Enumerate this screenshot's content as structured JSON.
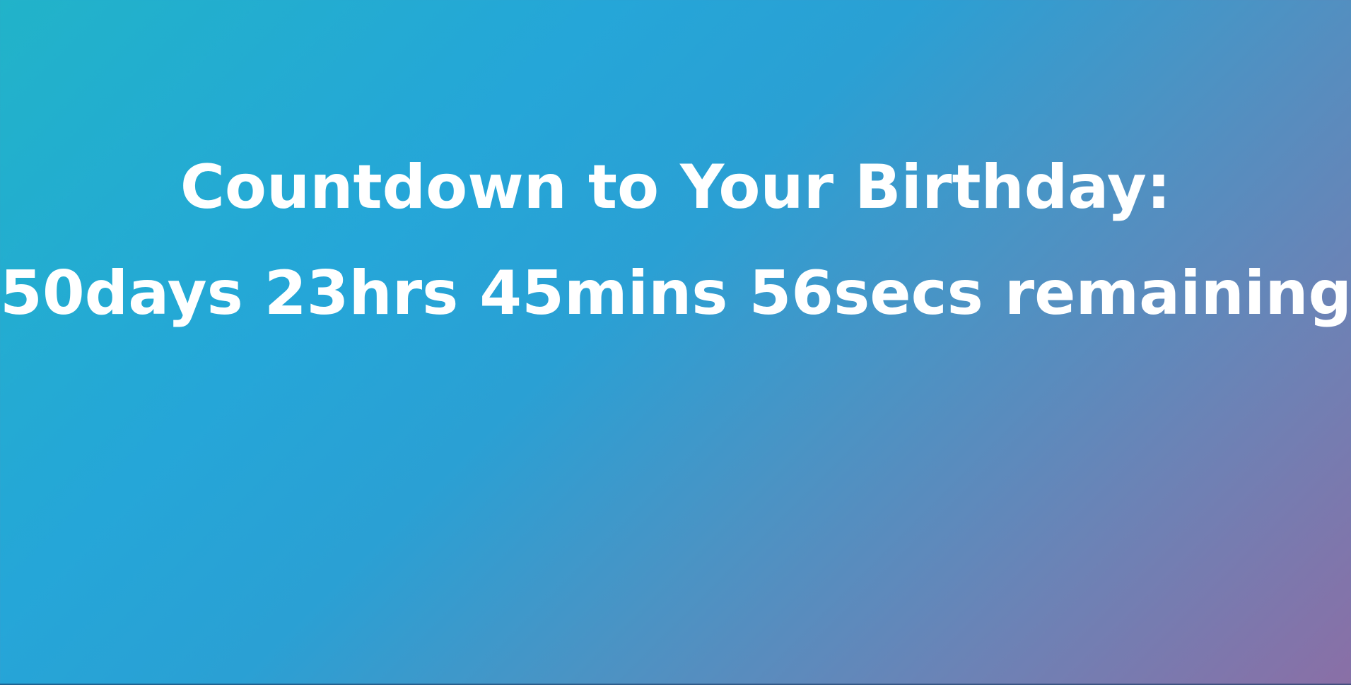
{
  "countdown": {
    "title": "Countdown to Your Birthday:",
    "days": "50days",
    "hours": "23hrs",
    "minutes": "45mins",
    "seconds": "56secs",
    "suffix": "remaining"
  },
  "colors": {
    "text": "#ffffff",
    "gradient_start": "#21b3c9",
    "gradient_mid": "#2aa0d4",
    "gradient_end": "#8a6fa6"
  }
}
